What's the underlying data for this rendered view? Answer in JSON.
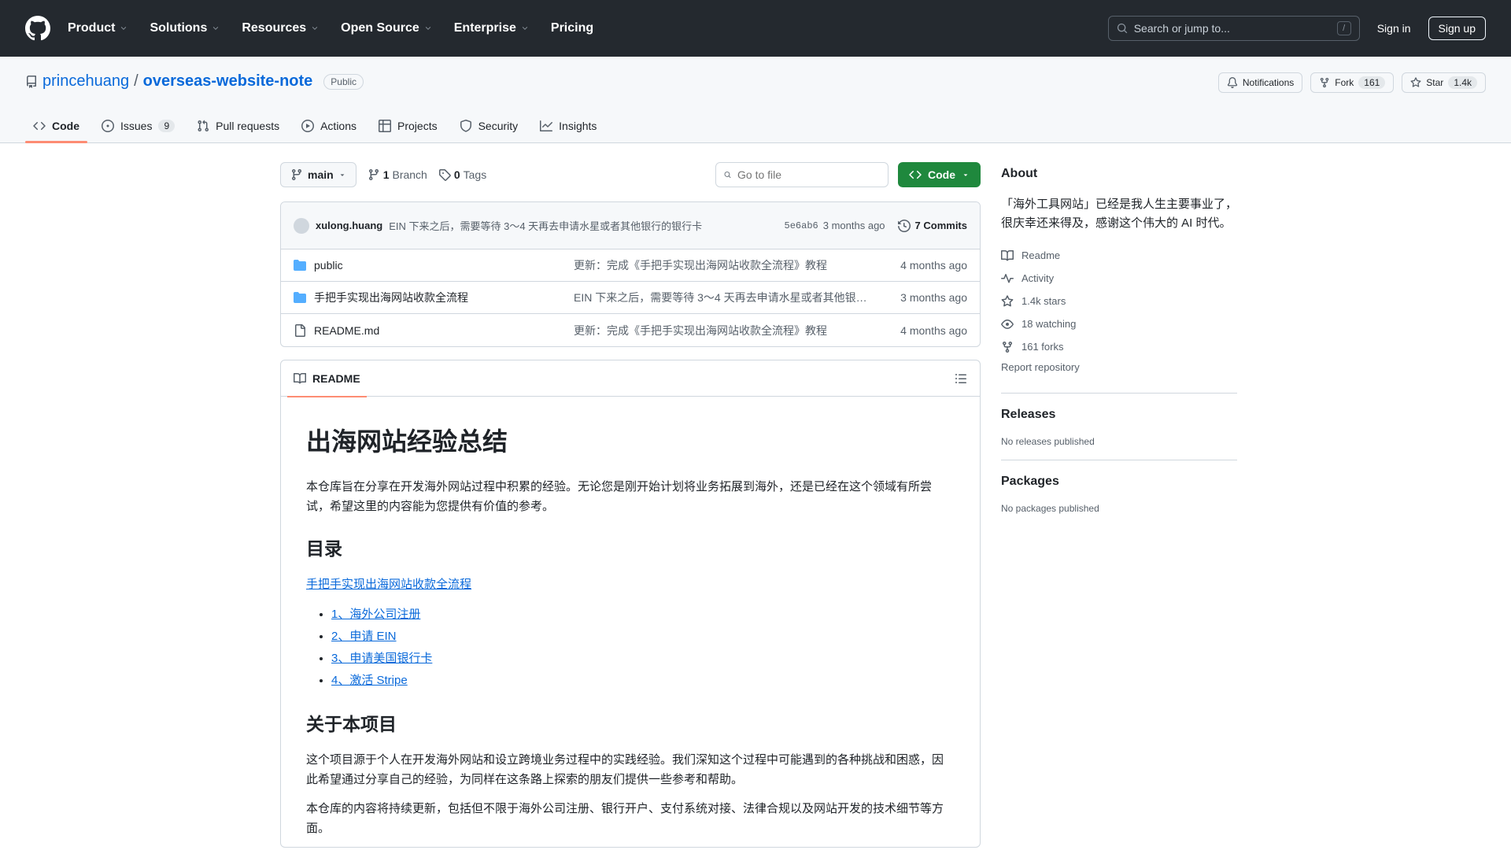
{
  "header": {
    "nav": [
      {
        "label": "Product",
        "dropdown": true
      },
      {
        "label": "Solutions",
        "dropdown": true
      },
      {
        "label": "Resources",
        "dropdown": true
      },
      {
        "label": "Open Source",
        "dropdown": true
      },
      {
        "label": "Enterprise",
        "dropdown": true
      },
      {
        "label": "Pricing",
        "dropdown": false
      }
    ],
    "search_placeholder": "Search or jump to...",
    "search_key": "/",
    "sign_in": "Sign in",
    "sign_up": "Sign up"
  },
  "repo": {
    "owner": "princehuang",
    "separator": "/",
    "name": "overseas-website-note",
    "visibility": "Public",
    "notifications": "Notifications",
    "fork_label": "Fork",
    "fork_count": "161",
    "star_label": "Star",
    "star_count": "1.4k"
  },
  "tabs": [
    {
      "label": "Code",
      "icon": "code-icon",
      "selected": true
    },
    {
      "label": "Issues",
      "icon": "issue-icon",
      "count": "9"
    },
    {
      "label": "Pull requests",
      "icon": "pull-request-icon"
    },
    {
      "label": "Actions",
      "icon": "play-icon"
    },
    {
      "label": "Projects",
      "icon": "table-icon"
    },
    {
      "label": "Security",
      "icon": "shield-icon"
    },
    {
      "label": "Insights",
      "icon": "graph-icon"
    }
  ],
  "filebar": {
    "branch": "main",
    "branches_count": "1",
    "branches_label": "Branch",
    "tags_count": "0",
    "tags_label": "Tags",
    "goto_placeholder": "Go to file",
    "code_button": "Code"
  },
  "latest_commit": {
    "author": "xulong.huang",
    "message": "EIN 下来之后，需要等待 3～4 天再去申请水星或者其他银行的银行卡",
    "sha": "5e6ab6",
    "time": "3 months ago",
    "commits_label": "7 Commits"
  },
  "files": [
    {
      "type": "dir",
      "name": "public",
      "message": "更新：完成《手把手实现出海网站收款全流程》教程",
      "time": "4 months ago"
    },
    {
      "type": "dir",
      "name": "手把手实现出海网站收款全流程",
      "message": "EIN 下来之后，需要等待 3～4 天再去申请水星或者其他银行...",
      "time": "3 months ago"
    },
    {
      "type": "file",
      "name": "README.md",
      "message": "更新：完成《手把手实现出海网站收款全流程》教程",
      "time": "4 months ago"
    }
  ],
  "readme": {
    "tab_label": "README",
    "title": "出海网站经验总结",
    "intro": "本仓库旨在分享在开发海外网站过程中积累的经验。无论您是刚开始计划将业务拓展到海外，还是已经在这个领域有所尝试，希望这里的内容能为您提供有价值的参考。",
    "toc_heading": "目录",
    "toc_link": "手把手实现出海网站收款全流程",
    "toc_items": [
      "1、海外公司注册",
      "2、申请 EIN",
      "3、申请美国银行卡",
      "4、激活 Stripe"
    ],
    "about_heading": "关于本项目",
    "about_p1": "这个项目源于个人在开发海外网站和设立跨境业务过程中的实践经验。我们深知这个过程中可能遇到的各种挑战和困惑，因此希望通过分享自己的经验，为同样在这条路上探索的朋友们提供一些参考和帮助。",
    "about_p2": "本仓库的内容将持续更新，包括但不限于海外公司注册、银行开户、支付系统对接、法律合规以及网站开发的技术细节等方面。"
  },
  "sidebar": {
    "about_heading": "About",
    "description": "「海外工具网站」已经是我人生主要事业了，很庆幸还来得及，感谢这个伟大的 AI 时代。",
    "items": [
      {
        "label": "Readme",
        "icon": "book-icon"
      },
      {
        "label": "Activity",
        "icon": "pulse-icon"
      },
      {
        "label": "1.4k stars",
        "icon": "star-icon"
      },
      {
        "label": "18 watching",
        "icon": "eye-icon"
      },
      {
        "label": "161 forks",
        "icon": "fork-icon"
      }
    ],
    "report": "Report repository",
    "releases_heading": "Releases",
    "releases_empty": "No releases published",
    "packages_heading": "Packages",
    "packages_empty": "No packages published"
  },
  "colors": {
    "header_bg": "#24292f",
    "link": "#0969da",
    "code_button": "#1f883d",
    "tab_underline": "#fd8c73",
    "folder": "#54aeff"
  }
}
